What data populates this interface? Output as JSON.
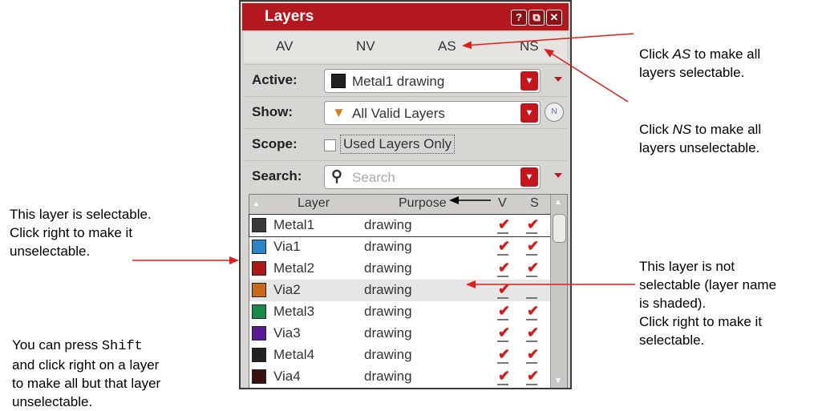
{
  "panel": {
    "title": "Layers",
    "help_label": "?",
    "float_label": "⧉",
    "close_label": "✕",
    "visibility_buttons": [
      "AV",
      "NV",
      "AS",
      "NS"
    ]
  },
  "controls": {
    "active": {
      "label": "Active:",
      "value": "Metal1 drawing",
      "swatch_color": "#222222"
    },
    "show": {
      "label": "Show:",
      "value": "All Valid Layers",
      "icon": "funnel-icon"
    },
    "scope": {
      "label": "Scope:",
      "checkbox_label": "Used Layers Only",
      "checked": false
    },
    "search": {
      "label": "Search:",
      "placeholder": "Search"
    }
  },
  "table": {
    "columns": [
      "Layer",
      "Purpose",
      "V",
      "S"
    ],
    "rows": [
      {
        "layer": "Metal1",
        "purpose": "drawing",
        "visible": true,
        "selectable": true,
        "swatch": "#3a3a3a",
        "selected": true
      },
      {
        "layer": "Via1",
        "purpose": "drawing",
        "visible": true,
        "selectable": true,
        "swatch": "#2a84c6"
      },
      {
        "layer": "Metal2",
        "purpose": "drawing",
        "visible": true,
        "selectable": true,
        "swatch": "#b01818"
      },
      {
        "layer": "Via2",
        "purpose": "drawing",
        "visible": true,
        "selectable": false,
        "swatch": "#c86a1c",
        "shaded": true
      },
      {
        "layer": "Metal3",
        "purpose": "drawing",
        "visible": true,
        "selectable": true,
        "swatch": "#1a8a4a"
      },
      {
        "layer": "Via3",
        "purpose": "drawing",
        "visible": true,
        "selectable": true,
        "swatch": "#5a1a9a"
      },
      {
        "layer": "Metal4",
        "purpose": "drawing",
        "visible": true,
        "selectable": true,
        "swatch": "#222222"
      },
      {
        "layer": "Via4",
        "purpose": "drawing",
        "visible": true,
        "selectable": true,
        "swatch": "#3a1010"
      }
    ]
  },
  "annotations": {
    "as_note_pre": "Click ",
    "as_note_key": "AS",
    "as_note_post": " to make all\nlayers selectable.",
    "ns_note_pre": "Click ",
    "ns_note_key": "NS",
    "ns_note_post": " to make all\nlayers unselectable.",
    "selectable_note": "This layer is selectable.\nClick right to make it\nunselectable.",
    "not_selectable_note": "This layer is not\nselectable (layer name\nis shaded).\nClick right to make it\nselectable.",
    "shift_pre": "You can press ",
    "shift_key": "Shift",
    "shift_post": "\nand click right on a layer\nto make all but that layer\nunselectable."
  }
}
